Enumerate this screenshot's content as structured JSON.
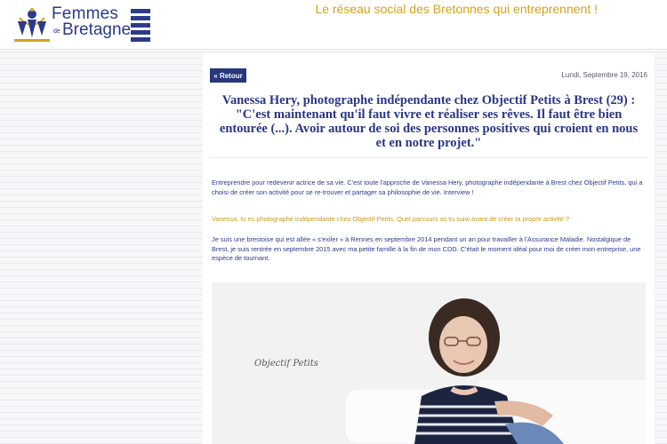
{
  "header": {
    "logo_line1": "Femmes",
    "logo_de": "de",
    "logo_line2": "Bretagne",
    "tagline": "Le réseau social des Bretonnes qui entreprennent !"
  },
  "article": {
    "back_label": "« Retour",
    "date": "Lundi, Septembre 19, 2016",
    "title": "Vanessa Hery, photographe indépendante chez Objectif Petits à Brest (29) : \"C'est maintenant qu'il faut vivre et réaliser ses rêves. Il faut être bien entourée (...). Avoir autour de soi des personnes positives qui croient en nous et en notre projet.\"",
    "intro": "Entreprendre pour redevenir actrice de sa vie. C'est toute l'approche de Vanessa Hery, photographe indépendante à Brest chez Objectif Petits, qui a choisi de créer son activité pour se re-trouver et partager sa philosophie de vie. Interview !",
    "question": "Vanessa, tu es photographe indépendante chez Objectif Petits. Quel parcours as-tu suivi avant de créer ta propre activité ?",
    "answer": "Je suis une brestoise qui est allée « s'exiler » à Rennes en septembre 2014 pendant un an pour travailler à l'Assurance Maladie. Nostalgique de Brest, je suis rentrée en septembre 2015 avec ma petite famille à la fin de mon CDD. C'était le moment idéal pour moi de créer mon entreprise, une espèce de tournant.",
    "photo_caption_text": "Objectif Petits"
  },
  "colors": {
    "brand_blue": "#2b3585",
    "accent_gold": "#d3a21d",
    "button_bg": "#27367d"
  }
}
